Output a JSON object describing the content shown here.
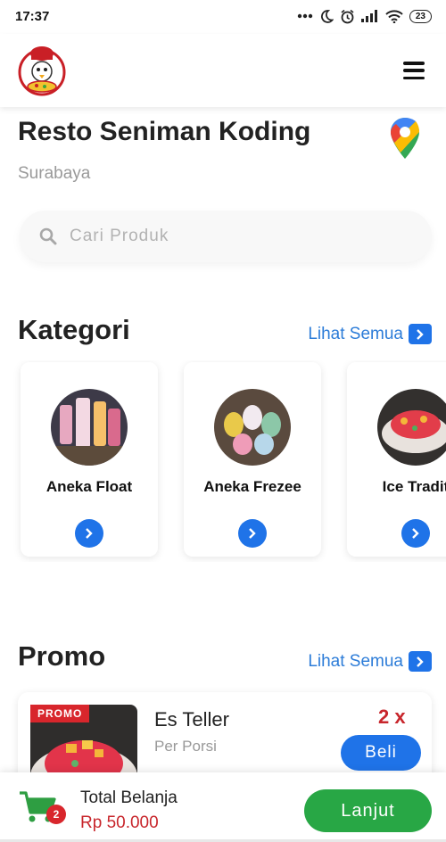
{
  "status_bar": {
    "time": "17:37",
    "battery": "23"
  },
  "header": {
    "logo": "restaurant-chef-logo",
    "menu_icon": "hamburger-menu-icon"
  },
  "restaurant": {
    "name": "Resto Seniman Koding",
    "city": "Surabaya",
    "map_icon": "google-maps-pin-icon"
  },
  "search": {
    "placeholder": "Cari Produk"
  },
  "categories": {
    "title": "Kategori",
    "see_all": "Lihat Semua",
    "items": [
      {
        "label": "Aneka Float"
      },
      {
        "label": "Aneka Frezee"
      },
      {
        "label": "Ice Tradit"
      }
    ]
  },
  "promo": {
    "title": "Promo",
    "see_all": "Lihat Semua",
    "items": [
      {
        "badge": "PROMO",
        "name": "Es Teller",
        "unit": "Per Porsi",
        "qty": "2 x",
        "button": "Beli"
      }
    ]
  },
  "cart": {
    "count": "2",
    "total_label": "Total Belanja",
    "total_value": "Rp 50.000",
    "next_button": "Lanjut"
  },
  "colors": {
    "accent": "#1f73e8",
    "price": "#c8262c",
    "success": "#28a745"
  }
}
